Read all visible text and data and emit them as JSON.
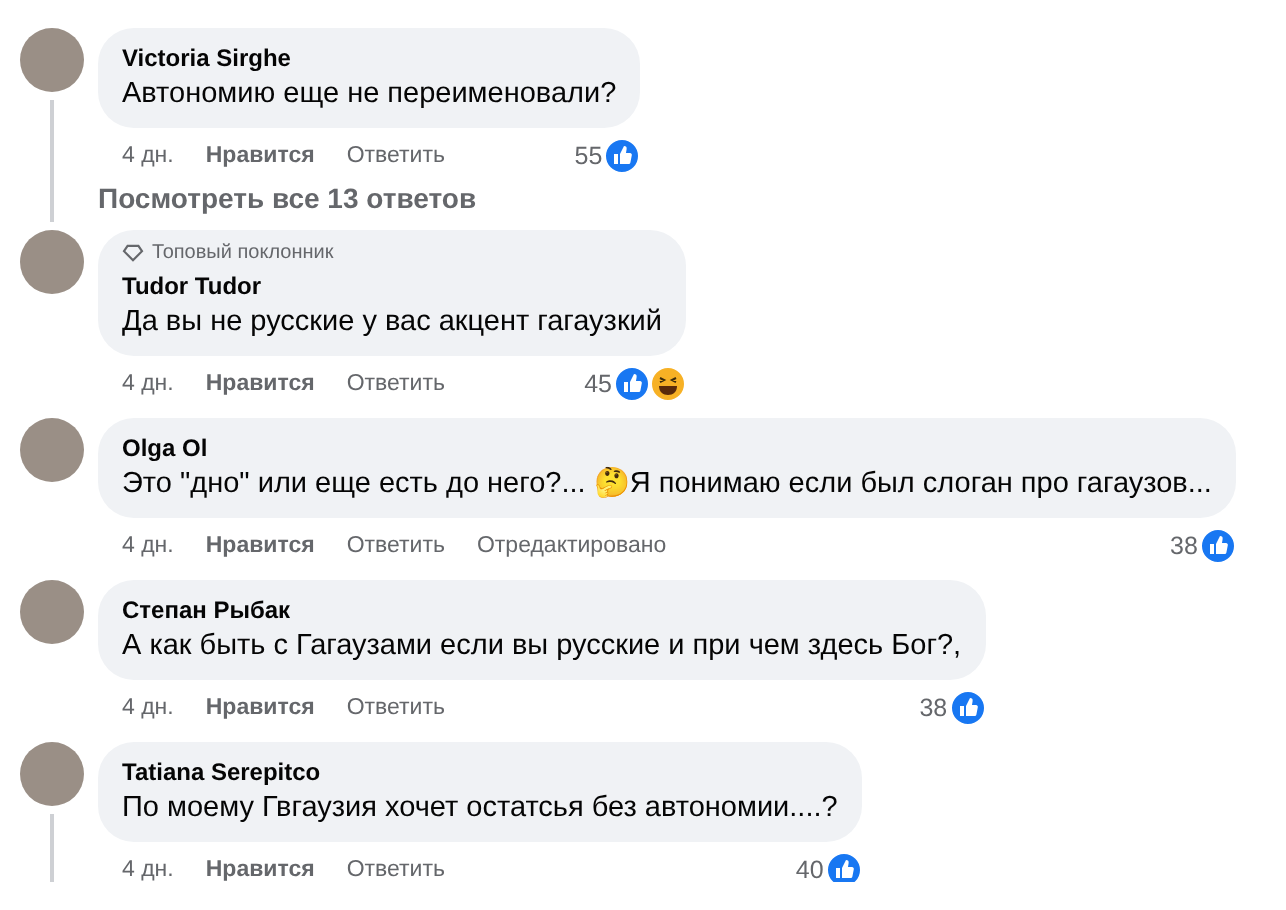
{
  "comments": [
    {
      "author": "Victoria Sirghe",
      "text": "Автономию еще не переименовали?",
      "time": "4 дн.",
      "like": "Нравится",
      "reply": "Ответить",
      "count": "55",
      "reactions": [
        {
          "kind": "like"
        }
      ],
      "thread": true,
      "view_replies": "Посмотреть все 13 ответов"
    },
    {
      "author": "Tudor Tudor",
      "badge": "Топовый поклонник",
      "text": "Да вы не русские у вас акцент гагаузкий",
      "time": "4 дн.",
      "like": "Нравится",
      "reply": "Ответить",
      "count": "45",
      "reactions": [
        {
          "kind": "like"
        },
        {
          "kind": "haha"
        }
      ]
    },
    {
      "author": "Olga Ol",
      "text": "Это \"дно\" или еще есть до него?... 🤔Я понимаю если был слоган про гагаузов...",
      "time": "4 дн.",
      "like": "Нравится",
      "reply": "Ответить",
      "edited": "Отредактировано",
      "count": "38",
      "reactions": [
        {
          "kind": "like"
        }
      ]
    },
    {
      "author": "Степан Рыбак",
      "text": "А как быть с Гагаузами если вы русские и при чем здесь Бог?,",
      "time": "4 дн.",
      "like": "Нравится",
      "reply": "Ответить",
      "count": "38",
      "reactions": [
        {
          "kind": "like"
        }
      ]
    },
    {
      "author": "Tatiana Serepitco",
      "text": "По моему Гвгаузия хочет остатсья без автономии....?",
      "time": "4 дн.",
      "like": "Нравится",
      "reply": "Ответить",
      "count": "40",
      "reactions": [
        {
          "kind": "like"
        }
      ],
      "thread": true
    }
  ]
}
